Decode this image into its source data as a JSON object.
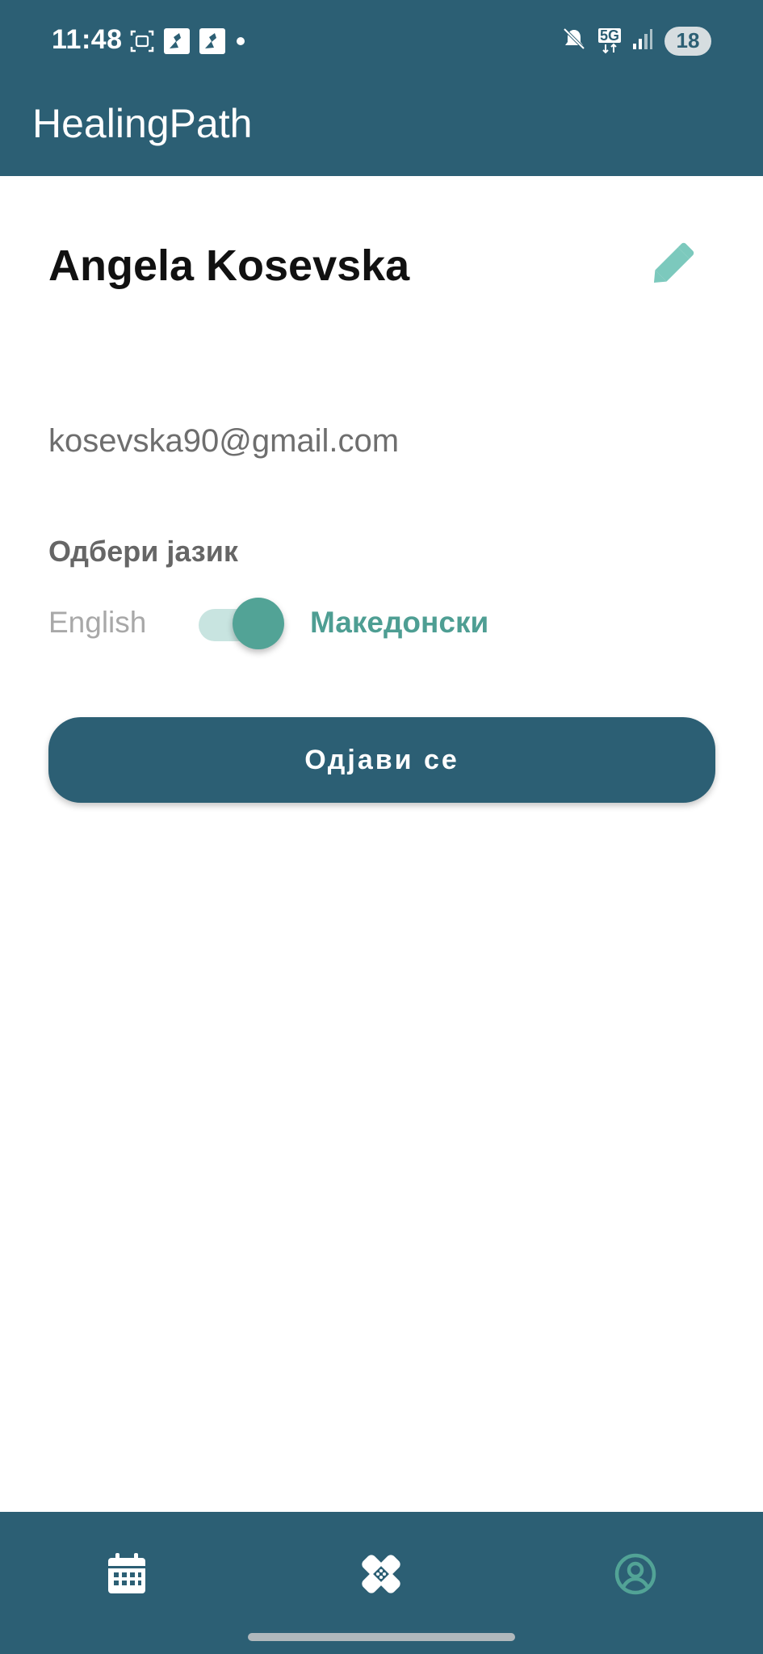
{
  "status_bar": {
    "time": "11:48",
    "network": "5G",
    "battery": "18",
    "icons": [
      "screenshot-icon",
      "app-notification-icon",
      "app-notification-icon",
      "dot-icon",
      "mute-icon",
      "network-5g-icon",
      "signal-icon",
      "battery-icon"
    ]
  },
  "app_bar": {
    "title": "HealingPath"
  },
  "profile": {
    "name": "Angela Kosevska",
    "email": "kosevska90@gmail.com",
    "edit_icon": "pencil-icon"
  },
  "language": {
    "heading": "Одбери јазик",
    "option_left": "English",
    "option_right": "Македонски",
    "selected": "Македонски",
    "toggle_on": true
  },
  "logout": {
    "label": "Одјави се"
  },
  "bottom_nav": {
    "items": [
      {
        "icon": "calendar-icon",
        "active": false
      },
      {
        "icon": "bandage-icon",
        "active": false
      },
      {
        "icon": "profile-icon",
        "active": true
      }
    ]
  },
  "colors": {
    "primary": "#2c5f74",
    "accent": "#52a396",
    "toggle_track": "#c8e4e0",
    "background": "#ffffff"
  }
}
